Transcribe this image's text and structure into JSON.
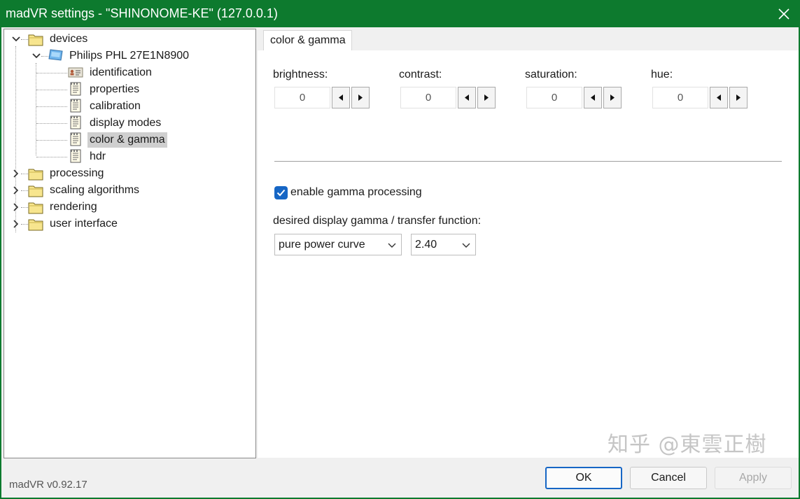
{
  "window": {
    "title": "madVR settings - \"SHINONOME-KE\" (127.0.0.1)",
    "title_color": "#0d7a2e"
  },
  "tree": {
    "root": {
      "label": "devices",
      "expanded": true
    },
    "device": {
      "label": "Philips PHL 27E1N8900",
      "expanded": true
    },
    "device_children": [
      "identification",
      "properties",
      "calibration",
      "display modes",
      "color & gamma",
      "hdr"
    ],
    "selected": "color & gamma",
    "collapsed_roots": [
      "processing",
      "scaling algorithms",
      "rendering",
      "user interface"
    ]
  },
  "tab": {
    "label": "color & gamma"
  },
  "controls": {
    "brightness": {
      "label": "brightness:",
      "value": "0"
    },
    "contrast": {
      "label": "contrast:",
      "value": "0"
    },
    "saturation": {
      "label": "saturation:",
      "value": "0"
    },
    "hue": {
      "label": "hue:",
      "value": "0"
    },
    "gamma_checkbox": {
      "label": "enable gamma processing",
      "checked": true
    },
    "gamma_label": "desired display gamma / transfer function:",
    "curve_select": {
      "value": "pure power curve"
    },
    "gamma_select": {
      "value": "2.40"
    }
  },
  "footer": {
    "version": "madVR v0.92.17",
    "ok": "OK",
    "cancel": "Cancel",
    "apply": "Apply"
  },
  "watermark": "知乎 @東雲正樹",
  "colors": {
    "accent": "#1666c5",
    "selection": "#cfcfcf"
  }
}
